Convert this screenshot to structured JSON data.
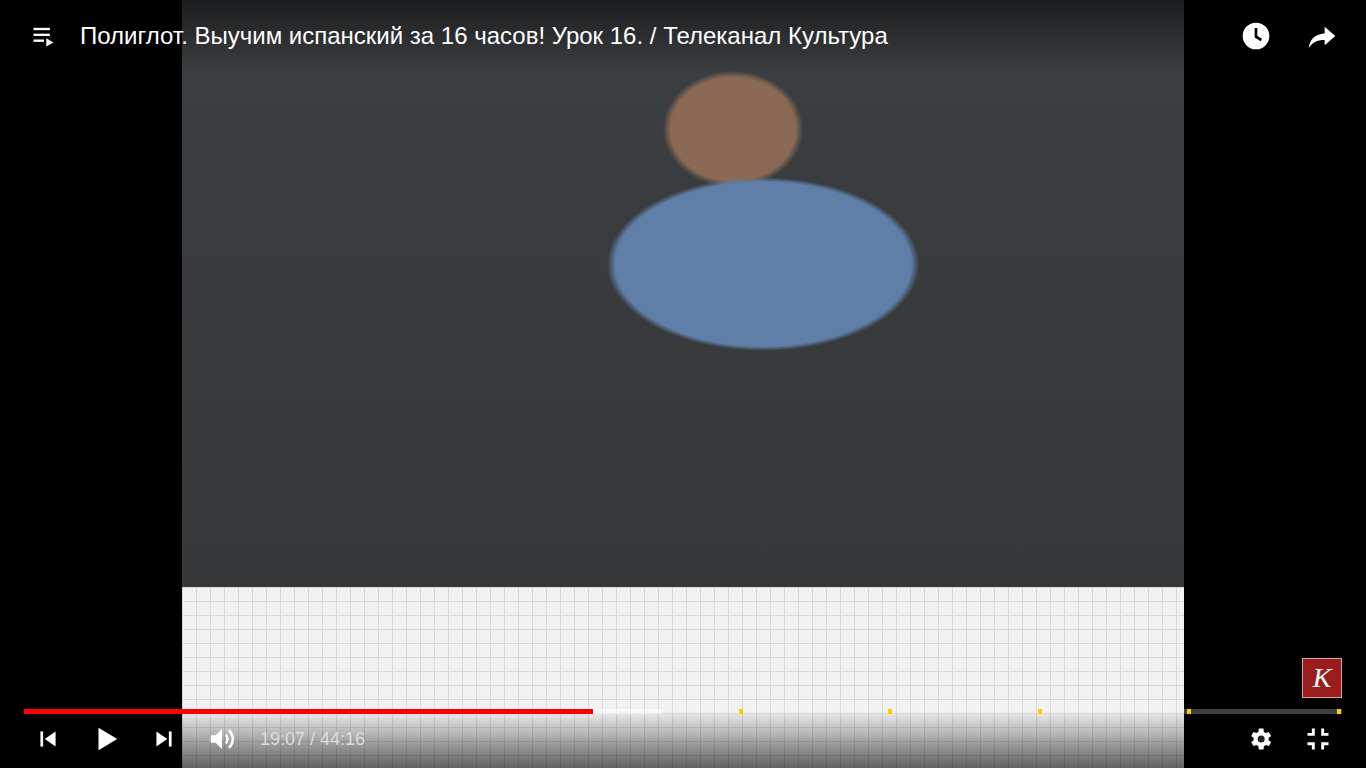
{
  "window": {
    "title": "Полиглот. Выучим испанский за 16 часов! Урок 16. / Телеканал Культура"
  },
  "player": {
    "playing": false,
    "muted": false,
    "fullscreen": true,
    "time": "19:07 / 44:16",
    "progress": {
      "level": 0.432,
      "buffered": 0.484,
      "markers": [
        0.544,
        0.657,
        0.771,
        0.884,
        0.998
      ]
    }
  },
  "watermark": {
    "text": "К"
  }
}
